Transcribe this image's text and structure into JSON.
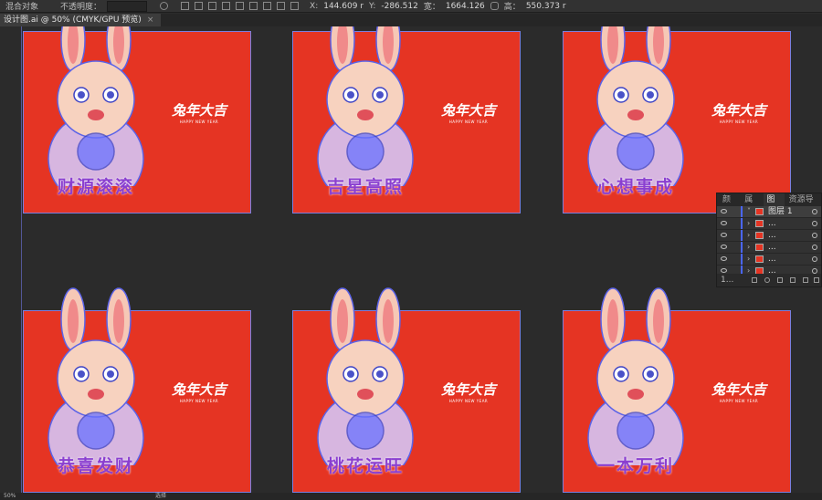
{
  "control_bar": {
    "blend_label": "混合对象",
    "opacity_label": "不透明度：",
    "x_label": "X:",
    "x_value": "144.609 r",
    "y_label": "Y:",
    "y_value": "-286.512",
    "w_label": "宽：",
    "w_value": "1664.126",
    "h_label": "高：",
    "h_value": "550.373 r"
  },
  "document_tab": {
    "title": "设计图.ai @ 50% (CMYK/GPU 预览)",
    "close": "×"
  },
  "envelopes": [
    {
      "slogan": "财源滚滚",
      "brand": "兔年大吉",
      "brand_sub": "HAPPY NEW YEAR"
    },
    {
      "slogan": "吉星高照",
      "brand": "兔年大吉",
      "brand_sub": "HAPPY NEW YEAR"
    },
    {
      "slogan": "心想事成",
      "brand": "兔年大吉",
      "brand_sub": "HAPPY NEW YEAR"
    },
    {
      "slogan": "恭喜发财",
      "brand": "兔年大吉",
      "brand_sub": "HAPPY NEW YEAR"
    },
    {
      "slogan": "桃花运旺",
      "brand": "兔年大吉",
      "brand_sub": "HAPPY NEW YEAR"
    },
    {
      "slogan": "一本万利",
      "brand": "兔年大吉",
      "brand_sub": "HAPPY NEW YEAR"
    }
  ],
  "layers_panel": {
    "tabs": [
      "颜色",
      "属性",
      "图层",
      "资源导出"
    ],
    "active_tab": "图层",
    "top_layer": "图层 1",
    "sublayer_name": "...",
    "layer_count": "1..."
  },
  "status_bar": {
    "zoom": "50%",
    "mode": "选择"
  },
  "colors": {
    "envelope_red": "#e53423",
    "selection_blue": "#5b63e8",
    "ui_dark": "#323232"
  }
}
